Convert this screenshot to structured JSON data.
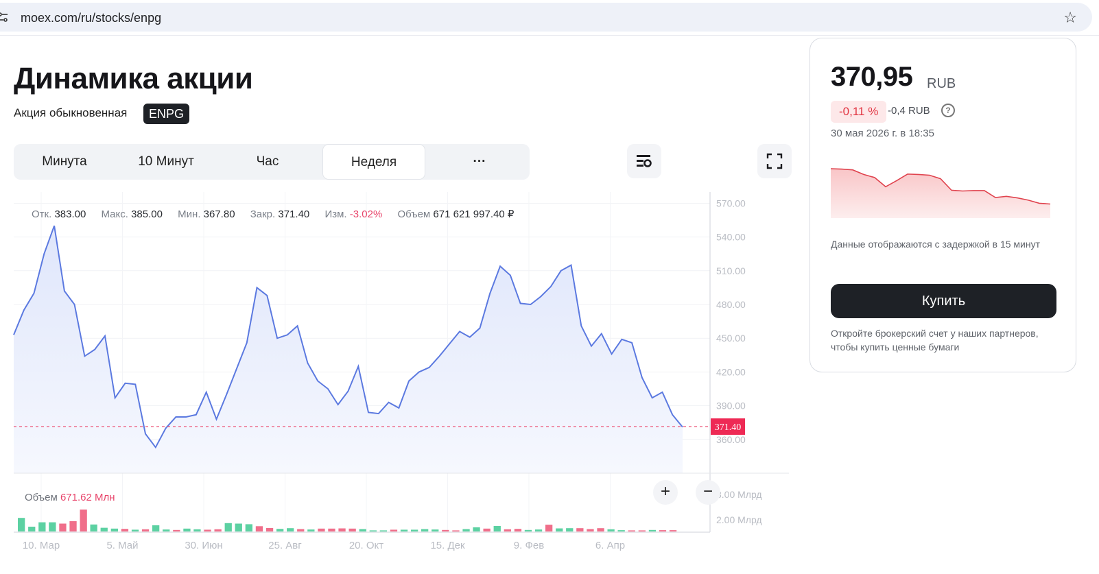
{
  "browser": {
    "url": "moex.com/ru/stocks/enpg"
  },
  "header": {
    "title": "Динамика акции",
    "subtitle": "Акция обыкновенная",
    "ticker": "ENPG"
  },
  "tabs": [
    {
      "label": "Минута"
    },
    {
      "label": "10 Минут"
    },
    {
      "label": "Час"
    },
    {
      "label": "Неделя",
      "active": true
    },
    {
      "label": "···"
    }
  ],
  "ohlc": {
    "open_label": "Отк.",
    "open": "383.00",
    "high_label": "Макс.",
    "high": "385.00",
    "low_label": "Мин.",
    "low": "367.80",
    "close_label": "Закр.",
    "close": "371.40",
    "change_label": "Изм.",
    "change": "-3.02%",
    "volume_label": "Объем",
    "volume": "671 621 997.40 ₽"
  },
  "volume_panel": {
    "label": "Объем",
    "value": "671.62 Млн",
    "ticks": [
      "8.00 Млрд",
      "2.00 Млрд"
    ]
  },
  "chart_data": {
    "type": "area",
    "y_ticks": [
      570,
      540,
      510,
      480,
      450,
      420,
      390,
      360
    ],
    "y_tick_labels": [
      "570.00",
      "540.00",
      "510.00",
      "480.00",
      "450.00",
      "420.00",
      "390.00",
      "360.00"
    ],
    "ylim": [
      330,
      580
    ],
    "x_labels": [
      "10. Мар",
      "5. Май",
      "30. Июн",
      "25. Авг",
      "20. Окт",
      "15. Дек",
      "9. Фев",
      "6. Апр"
    ],
    "last_value_label": "371.40",
    "last_value": 371.4,
    "values": [
      453,
      475,
      490,
      525,
      550,
      492,
      480,
      434,
      440,
      452,
      397,
      410,
      409,
      365,
      353,
      370,
      380,
      380,
      382,
      402,
      378,
      400,
      423,
      446,
      495,
      488,
      450,
      453,
      461,
      428,
      412,
      405,
      391,
      403,
      425,
      384,
      383,
      393,
      388,
      412,
      420,
      424,
      434,
      445,
      456,
      451,
      459,
      490,
      514,
      506,
      481,
      480,
      487,
      496,
      510,
      515,
      461,
      443,
      454,
      436,
      449,
      446,
      415,
      397,
      402,
      382,
      371
    ],
    "volume_values": [
      0.62,
      0.22,
      0.42,
      0.42,
      0.36,
      0.47,
      1.0,
      0.32,
      0.17,
      0.13,
      0.12,
      0.08,
      0.1,
      0.28,
      0.09,
      0.07,
      0.13,
      0.1,
      0.08,
      0.1,
      0.38,
      0.36,
      0.33,
      0.24,
      0.16,
      0.12,
      0.15,
      0.11,
      0.09,
      0.13,
      0.13,
      0.14,
      0.13,
      0.11,
      0.05,
      0.05,
      0.08,
      0.08,
      0.08,
      0.11,
      0.09,
      0.07,
      0.05,
      0.11,
      0.19,
      0.13,
      0.25,
      0.1,
      0.12,
      0.07,
      0.09,
      0.31,
      0.14,
      0.15,
      0.15,
      0.11,
      0.15,
      0.1,
      0.06,
      0.05,
      0.05,
      0.07,
      0.06,
      0.06
    ],
    "volume_colors_up": [
      true,
      true,
      true,
      true,
      false,
      false,
      false,
      true,
      true,
      true,
      false,
      true,
      false,
      true,
      true,
      false,
      true,
      true,
      false,
      false,
      true,
      true,
      true,
      false,
      false,
      true,
      true,
      false,
      true,
      false,
      false,
      false,
      false,
      true,
      true,
      true,
      false,
      true,
      true,
      true,
      true,
      false,
      false,
      true,
      true,
      false,
      true,
      false,
      false,
      true,
      true,
      false,
      true,
      true,
      false,
      false,
      false,
      true,
      true,
      false,
      false,
      true,
      false,
      false
    ],
    "color_line": "#5b79e0",
    "color_up": "#5cd1a2",
    "color_down": "#f06e8a"
  },
  "card": {
    "price": "370,95",
    "currency": "RUB",
    "pct_change": "-0,11 %",
    "abs_change": "-0,4 RUB",
    "timestamp": "30 мая 2026 г. в 18:35",
    "mini_values": [
      1.0,
      0.99,
      0.97,
      0.85,
      0.77,
      0.53,
      0.69,
      0.86,
      0.85,
      0.83,
      0.74,
      0.44,
      0.42,
      0.43,
      0.43,
      0.25,
      0.28,
      0.24,
      0.18,
      0.1,
      0.08
    ],
    "delay_note": "Данные отображаются с задержкой в 15 минут",
    "buy_label": "Купить",
    "buy_note": "Откройте брокерский счет у наших партнеров, чтобы купить ценные бумаги"
  }
}
